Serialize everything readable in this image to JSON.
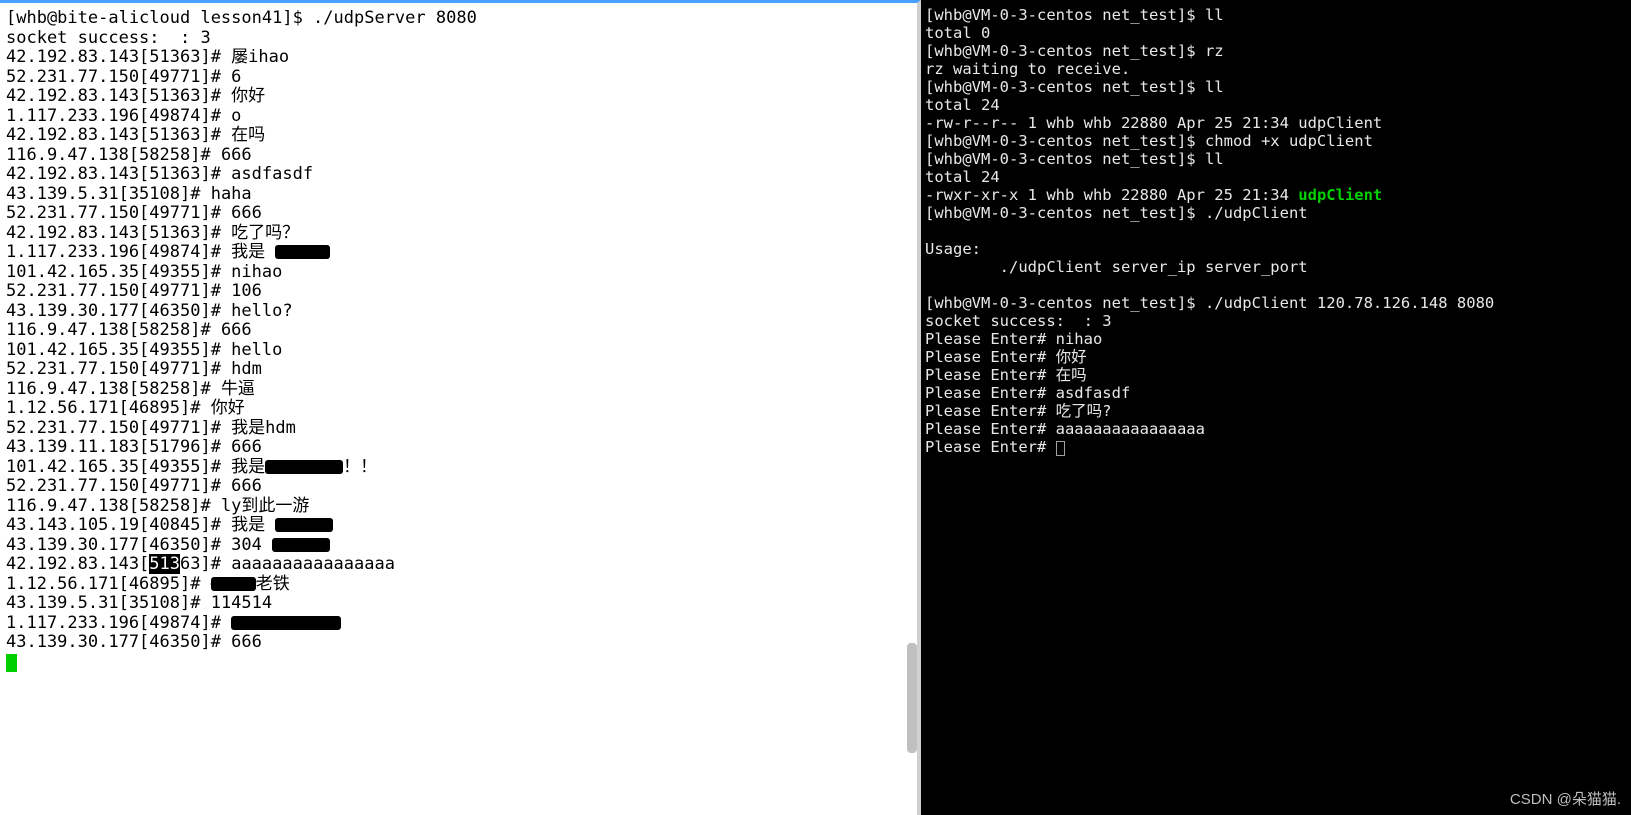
{
  "left_terminal": {
    "prompt": "[whb@bite-alicloud lesson41]$ ",
    "command": "./udpServer 8080",
    "socket_line": "socket success:  : 3",
    "lines": [
      {
        "addr": "42.192.83.143[51363]# ",
        "msg": "屡ihao"
      },
      {
        "addr": "52.231.77.150[49771]# ",
        "msg": "6"
      },
      {
        "addr": "42.192.83.143[51363]# ",
        "msg": "你好"
      },
      {
        "addr": "1.117.233.196[49874]# ",
        "msg": "o"
      },
      {
        "addr": "42.192.83.143[51363]# ",
        "msg": "在吗"
      },
      {
        "addr": "116.9.47.138[58258]# ",
        "msg": "666"
      },
      {
        "addr": "42.192.83.143[51363]# ",
        "msg": "asdfasdf"
      },
      {
        "addr": "43.139.5.31[35108]# ",
        "msg": "haha"
      },
      {
        "addr": "52.231.77.150[49771]# ",
        "msg": "666"
      },
      {
        "addr": "42.192.83.143[51363]# ",
        "msg": "吃了吗？"
      },
      {
        "addr": "1.117.233.196[49874]# ",
        "msg": "我是 ",
        "redact_w": 55
      },
      {
        "addr": "101.42.165.35[49355]# ",
        "msg": "nihao"
      },
      {
        "addr": "52.231.77.150[49771]# ",
        "msg": "106"
      },
      {
        "addr": "43.139.30.177[46350]# ",
        "msg": "hello?"
      },
      {
        "addr": "116.9.47.138[58258]# ",
        "msg": "666"
      },
      {
        "addr": "101.42.165.35[49355]# ",
        "msg": "hello"
      },
      {
        "addr": "52.231.77.150[49771]# ",
        "msg": "hdm"
      },
      {
        "addr": "116.9.47.138[58258]# ",
        "msg": "牛逼"
      },
      {
        "addr": "1.12.56.171[46895]# ",
        "msg": "你好"
      },
      {
        "addr": "52.231.77.150[49771]# ",
        "msg": "我是hdm"
      },
      {
        "addr": "43.139.11.183[51796]# ",
        "msg": "666"
      },
      {
        "addr": "101.42.165.35[49355]# ",
        "msg": "我是",
        "redact_w": 78,
        "tail": "！！"
      },
      {
        "addr": "52.231.77.150[49771]# ",
        "msg": "666"
      },
      {
        "addr": "116.9.47.138[58258]# ",
        "msg": "ly到此一游"
      },
      {
        "addr": "43.143.105.19[40845]# ",
        "msg": "我是 ",
        "redact_w": 58
      },
      {
        "addr": "43.139.30.177[46350]# ",
        "msg": "304 ",
        "redact_w": 58
      },
      {
        "addr_pre": "42.192.83.143[",
        "addr_sel": "513",
        "addr_post": "63]# ",
        "msg": "aaaaaaaaaaaaaaaa"
      },
      {
        "addr": "1.12.56.171[46895]# ",
        "redact_w": 45,
        "tail": "老铁"
      },
      {
        "addr": "43.139.5.31[35108]# ",
        "msg": "114514"
      },
      {
        "addr": "1.117.233.196[49874]# ",
        "redact_w": 110
      },
      {
        "addr": "43.139.30.177[46350]# ",
        "msg": "666"
      }
    ]
  },
  "right_terminal": {
    "lines": [
      {
        "t": "[whb@VM-0-3-centos net_test]$ ll"
      },
      {
        "t": "total 0"
      },
      {
        "t": "[whb@VM-0-3-centos net_test]$ rz"
      },
      {
        "t": "rz waiting to receive."
      },
      {
        "t": "[whb@VM-0-3-centos net_test]$ ll"
      },
      {
        "t": "total 24"
      },
      {
        "t": "-rw-r--r-- 1 whb whb 22880 Apr 25 21:34 udpClient"
      },
      {
        "t": "[whb@VM-0-3-centos net_test]$ chmod +x udpClient"
      },
      {
        "t": "[whb@VM-0-3-centos net_test]$ ll"
      },
      {
        "t": "total 24"
      },
      {
        "pre": "-rwxr-xr-x 1 whb whb 22880 Apr 25 21:34 ",
        "exec": "udpClient"
      },
      {
        "t": "[whb@VM-0-3-centos net_test]$ ./udpClient"
      },
      {
        "t": ""
      },
      {
        "t": "Usage:"
      },
      {
        "t": "        ./udpClient server_ip server_port"
      },
      {
        "t": ""
      },
      {
        "t": "[whb@VM-0-3-centos net_test]$ ./udpClient 120.78.126.148 8080"
      },
      {
        "t": "socket success:  : 3"
      },
      {
        "t": "Please Enter# nihao"
      },
      {
        "t": "Please Enter# 你好"
      },
      {
        "t": "Please Enter# 在吗"
      },
      {
        "t": "Please Enter# asdfasdf"
      },
      {
        "t": "Please Enter# 吃了吗?"
      },
      {
        "t": "Please Enter# aaaaaaaaaaaaaaaa"
      },
      {
        "t": "Please Enter# ",
        "cursor": true
      }
    ]
  },
  "watermark": "CSDN @朵猫猫."
}
